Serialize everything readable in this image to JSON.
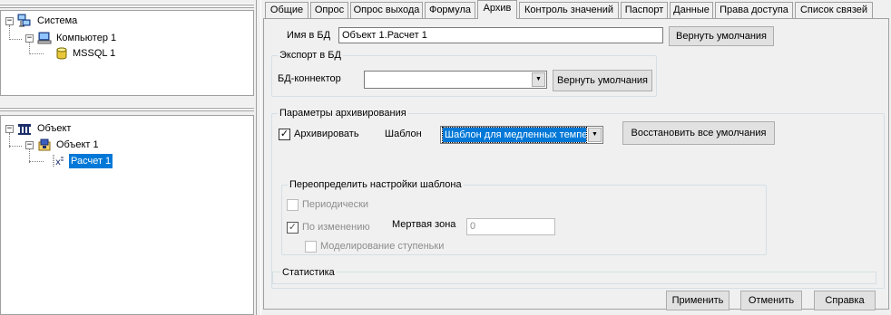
{
  "tree_top": {
    "nodes": [
      {
        "label": "Система",
        "expander": "−"
      },
      {
        "label": "Компьютер 1",
        "expander": "−"
      },
      {
        "label": "MSSQL 1"
      }
    ]
  },
  "tree_bottom": {
    "nodes": [
      {
        "label": "Объект",
        "expander": "−"
      },
      {
        "label": "Объект 1",
        "expander": "−"
      },
      {
        "label": "Расчет 1"
      }
    ]
  },
  "tabs": [
    {
      "label": "Общие"
    },
    {
      "label": "Опрос"
    },
    {
      "label": "Опрос выхода"
    },
    {
      "label": "Формула"
    },
    {
      "label": "Архив"
    },
    {
      "label": "Контроль значений"
    },
    {
      "label": "Паспорт"
    },
    {
      "label": "Данные"
    },
    {
      "label": "Права доступа"
    },
    {
      "label": "Список связей"
    }
  ],
  "active_tab": "Архив",
  "db_name": {
    "label": "Имя в БД",
    "value": "Объект 1.Расчет 1",
    "reset_button": "Вернуть умолчания"
  },
  "export_group": {
    "title": "Экспорт в БД",
    "connector_label": "БД-коннектор",
    "connector_value": "",
    "reset_button": "Вернуть умолчания"
  },
  "archive_params": {
    "title": "Параметры архивирования",
    "archive_checkbox": {
      "label": "Архивировать",
      "checked": true
    },
    "template_label": "Шаблон",
    "template_value": "Шаблон для медленных темпер",
    "restore_button": "Восстановить все умолчания"
  },
  "override_group": {
    "title": "Переопределить настройки шаблона",
    "periodic": {
      "label": "Периодически",
      "checked": false
    },
    "on_change": {
      "label": "По изменению",
      "checked": true
    },
    "dead_zone_label": "Мертвая зона",
    "dead_zone_value": "0",
    "step_modeling": {
      "label": "Моделирование ступеньки",
      "checked": false
    }
  },
  "statistics": {
    "title": "Статистика"
  },
  "footer": {
    "apply": "Применить",
    "cancel": "Отменить",
    "help": "Справка"
  },
  "colors": {
    "selection": "#0078d7",
    "window_bg": "#f0f0f0",
    "disabled_text": "#8d8d8d"
  },
  "icons": {
    "system": "network-computers-icon",
    "computer": "computer-icon",
    "database": "database-cylinder-icon",
    "object_root": "object-group-icon",
    "object": "object-folder-icon",
    "calculation": "calculation-icon"
  }
}
